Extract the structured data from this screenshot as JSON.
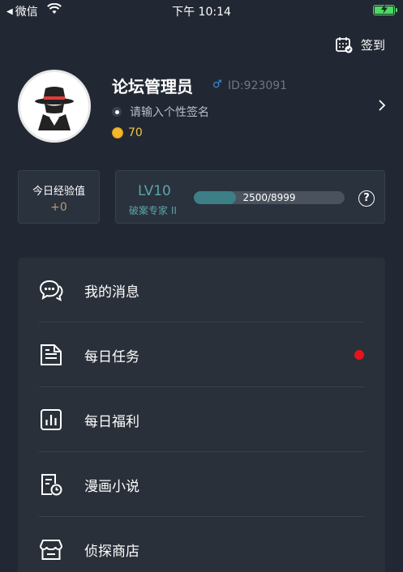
{
  "status_bar": {
    "back_app": "微信",
    "time": "下午 10:14"
  },
  "header": {
    "checkin_label": "签到"
  },
  "profile": {
    "username": "论坛管理员",
    "gender_symbol": "♂",
    "id_text": "ID:923091",
    "signature_placeholder": "请输入个性签名",
    "coins": "70"
  },
  "exp": {
    "title": "今日经验值",
    "value": "+0"
  },
  "level": {
    "level_label": "LV10",
    "title": "破案专家 II",
    "progress_text": "2500/8999",
    "progress_fraction": 0.278,
    "help_symbol": "?"
  },
  "menu": {
    "items": [
      {
        "label": "我的消息",
        "icon": "chat-bubbles-icon",
        "badge": false
      },
      {
        "label": "每日任务",
        "icon": "document-icon",
        "badge": true
      },
      {
        "label": "每日福利",
        "icon": "bar-chart-icon",
        "badge": false
      },
      {
        "label": "漫画小说",
        "icon": "book-clock-icon",
        "badge": false
      },
      {
        "label": "侦探商店",
        "icon": "store-icon",
        "badge": false
      }
    ]
  },
  "colors": {
    "background": "#222833",
    "panel": "#293039",
    "accent_teal": "#5aa5a8",
    "coin_gold": "#f4c443",
    "badge_red": "#e8131d"
  }
}
